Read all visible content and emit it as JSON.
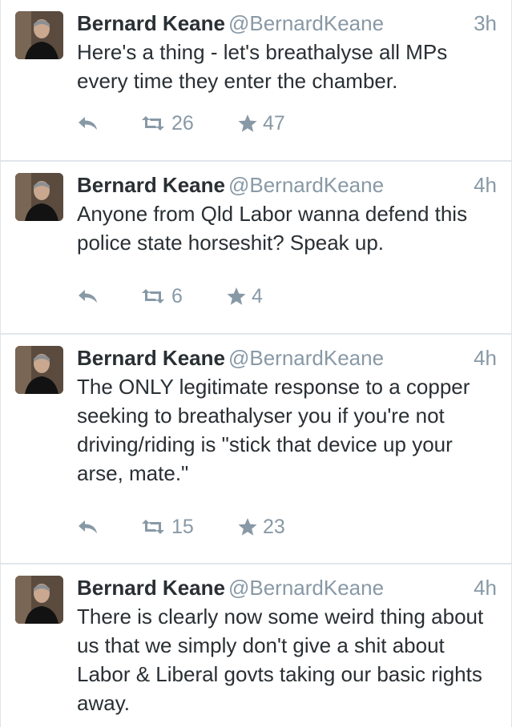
{
  "tweets": [
    {
      "name": "Bernard Keane",
      "handle": "@BernardKeane",
      "time": "3h",
      "text": "Here's a thing - let's breathalyse all MPs every time they enter the chamber.",
      "retweets": "26",
      "favorites": "47"
    },
    {
      "name": "Bernard Keane",
      "handle": "@BernardKeane",
      "time": "4h",
      "text": "Anyone from Qld Labor wanna defend this police state horseshit? Speak up.",
      "retweets": "6",
      "favorites": "4"
    },
    {
      "name": "Bernard Keane",
      "handle": "@BernardKeane",
      "time": "4h",
      "text": "The ONLY legitimate response to a copper seeking to breathalyser you if you're not driving/riding is \"stick that device up your arse, mate.\"",
      "retweets": "15",
      "favorites": "23"
    },
    {
      "name": "Bernard Keane",
      "handle": "@BernardKeane",
      "time": "4h",
      "text": "There is clearly now some weird thing about us that we simply don't give a shit about Labor & Liberal govts taking our basic rights away."
    }
  ],
  "icons": {
    "reply": "reply-icon",
    "retweet": "retweet-icon",
    "favorite": "star-icon",
    "avatar": "avatar-photo"
  },
  "colors": {
    "name": "#292f33",
    "meta": "#8899a6",
    "separator": "#e1e6ec"
  }
}
